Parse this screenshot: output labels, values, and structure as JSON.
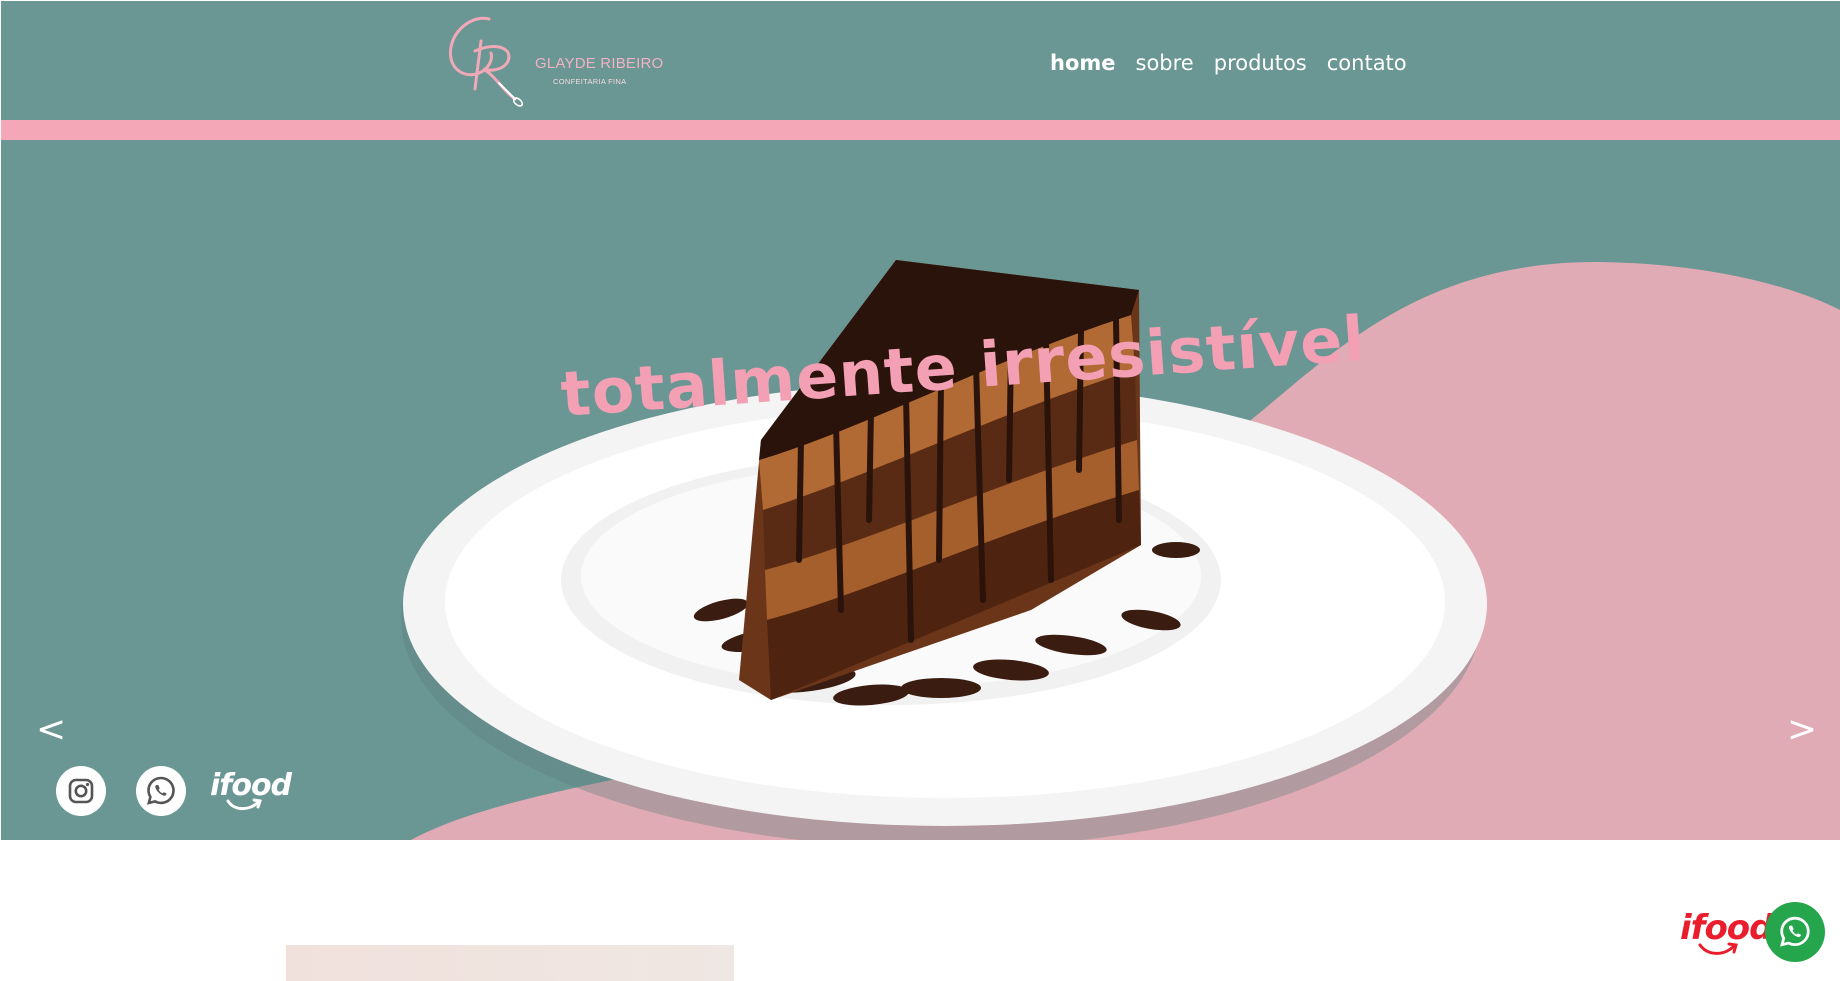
{
  "brand": {
    "name": "GLAYDE RIBEIRO",
    "subtitle": "CONFEITARIA FINA"
  },
  "nav": {
    "items": [
      {
        "label": "home",
        "active": true
      },
      {
        "label": "sobre",
        "active": false
      },
      {
        "label": "produtos",
        "active": false
      },
      {
        "label": "contato",
        "active": false
      }
    ]
  },
  "hero": {
    "title": "totalmente irresistível",
    "prev_label": "<",
    "next_label": ">",
    "image_icon": "chocolate-cake-slice-on-plate"
  },
  "social": {
    "instagram_icon": "instagram-icon",
    "whatsapp_icon": "whatsapp-icon",
    "ifood_label": "ifood"
  },
  "floating": {
    "ifood_label": "ifood",
    "whatsapp_icon": "whatsapp-icon"
  },
  "colors": {
    "teal": "#6a9694",
    "pink": "#f4a7b6",
    "pink_blob": "#e0abb4",
    "title_pink": "#f4a0b4",
    "ifood_red": "#ea1d2c",
    "whatsapp_green": "#25a64d"
  }
}
